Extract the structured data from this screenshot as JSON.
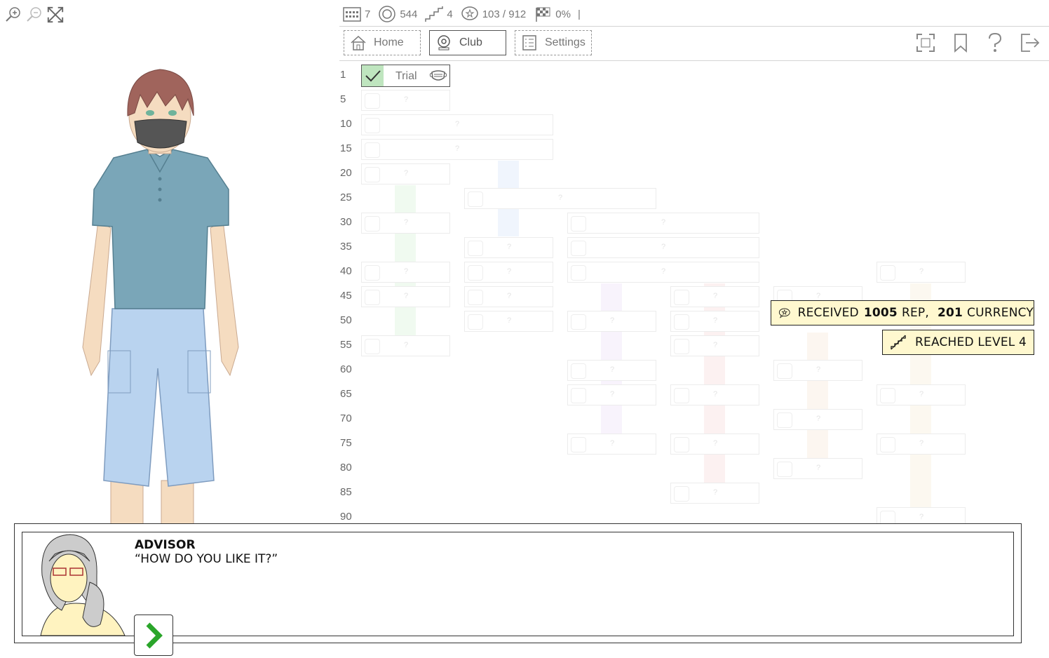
{
  "status": {
    "day": "7",
    "reputation": "544",
    "level": "4",
    "currency": "103 / 912",
    "progress": "0%",
    "separator": "|"
  },
  "nav": {
    "home": "Home",
    "club": "Club",
    "settings": "Settings"
  },
  "rows": [
    "1",
    "5",
    "10",
    "15",
    "20",
    "25",
    "30",
    "35",
    "40",
    "45",
    "50",
    "55",
    "60",
    "65",
    "70",
    "75",
    "80",
    "85",
    "90"
  ],
  "trial_label": "Trial",
  "unknown_mark": "?",
  "notifications": {
    "received_prefix": "RECEIVED",
    "received_rep_value": "1005",
    "received_rep_unit": "REP,",
    "received_cur_value": "201",
    "received_cur_unit": "CURRENCY",
    "level_text": "REACHED LEVEL 4"
  },
  "dialog": {
    "speaker": "ADVISOR",
    "line": "“HOW DO YOU LIKE IT?”"
  },
  "colors": {
    "accent_green": "#2aa52a",
    "check_bg": "#bfe5bf",
    "notif_bg": "#fff8cf",
    "shirt": "#7aa6b8",
    "shorts": "#b9d3ef"
  }
}
